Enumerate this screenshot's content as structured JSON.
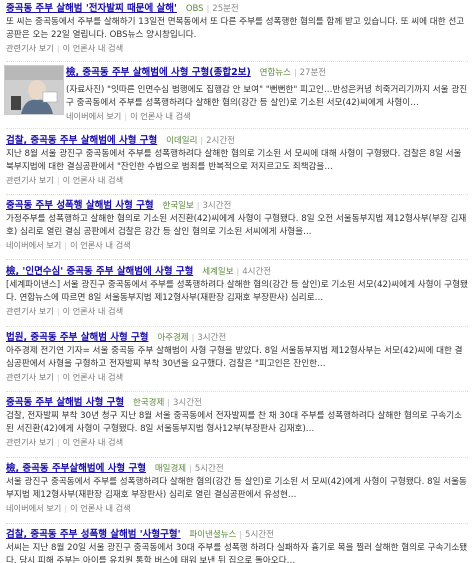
{
  "results": [
    {
      "title": "중곡동 주부 살해범 '전자발찌 때문에 살해'",
      "source": "OBS",
      "time": "25분전",
      "snippet": "또 씨는 중곡동에서 주부를 살해하기 13일전 면목동에서 또 다른 주부를 성폭행한 혐의를 함께 받고 있습니다. 또 씨에 대한 선고공판은 오는 22일 열립니다. OBS뉴스 양시창입니다.",
      "link_related": "관련기사 보기",
      "link_same": "이 언론사 내 검색"
    },
    {
      "title": "檢, 중곡동 주부 살해범에 사형 구형(종합2보)",
      "source": "연합뉴스",
      "time": "27분전",
      "snippet": "(자료사진) \"잇따른 인면수심 범행에도 집행감 안 보여\" \"뻔뻔한\" 피고인…반성은커녕 히죽거리기까지 서울 광진구 중곡동에서 주부를 성폭행하려다 살해한 혐의(강간 등 살인)로 기소된 서모(42)씨에게 사형이…",
      "link_related": "네이버에서 보기",
      "link_same": "이 언론사 내 검색"
    },
    {
      "title": "검찰, 중곡동 주부 살해범에 사형 구형",
      "source": "이데일리",
      "time": "2시간전",
      "snippet": "지난 8월 서울 광진구 중곡동에서 주부를 성폭행하려다 살해한 혐의로 기소된 서 모씨에 대해 사형이 구형됐다. 검찰은 8일 서울북부지법에 대한 결심공판에서 \"잔인한 수법으로 범죄를 반복적으로 저지르고도 죄책감을…",
      "link_related": "관련기사 보기",
      "link_same": "이 언론사 내 검색"
    },
    {
      "title": "중곡동 주부 성폭행 살해범 사형 구형",
      "source": "한국일보",
      "time": "3시간전",
      "snippet": "가정주부를 성폭행하고 살해한 혐의로 기소된 서진환(42)씨에게 사형이 구형됐다. 8일 오전 서울동부지법 제12형사부(부장 김재호) 심리로 열린 결심 공판에서 검찰은 강간 등 살인 혐의로 기소된 서씨에게 사형을…",
      "link_related": "네이버에서 보기",
      "link_same": "이 언론사 내 검색"
    },
    {
      "title": "檢, '인면수심' 중곡동 주부 살해범에 사형 구형",
      "source": "세계일보",
      "time": "4시간전",
      "snippet": "[세계파이낸스] 서울 광진구 중곡동에서 주부를 성폭행하려다 살해한 혐의(강간 등 살인)로 기소된 서모(42)씨에게 사형이 구형됐다. 연합뉴스에 따르면 8일 서울동부지법 제12형사부(재판장 김재호 부장판사) 심리로…",
      "link_related": "관련기사 보기",
      "link_same": "이 언론사 내 검색"
    },
    {
      "title": "법원, 중곡동 주부 살해범 사형 구형",
      "source": "아주경제",
      "time": "3시간전",
      "snippet": "아주경제 전기연 기자= 서울 중곡동 주부 살해범이 사형 구형을 받았다. 8일 서울동부지법 제12형사부는 서모(42)씨에 대한 결심공판에서 사형을 구형하고 전자발찌 부착 30년을 요구했다. 검찰은 \"피고인은 잔인한…",
      "link_related": "관련기사 보기",
      "link_same": "이 언론사 내 검색"
    },
    {
      "title": "중곡동 주부 살해범 사형 구형",
      "source": "한국경제",
      "time": "3시간전",
      "snippet": "검찰, 전자발찌 부착 30년 청구 지난 8월 서울 중곡동에서 전자발찌를 찬 채 30대 주부를 성폭행하려다 살해한 혐의로 구속기소된 서진환(42)에게 사형이 구형됐다. 8일 서울동부지법 형사12부(부장판사 김재호)…",
      "link_related": "관련기사 보기",
      "link_same": "이 언론사 내 검색"
    },
    {
      "title": "檢, 중곡동 주부살해범에 사형 구형",
      "source": "매일경제",
      "time": "5시간전",
      "snippet": "서울 광진구 중곡동에서 주부를 성폭행하려다 살해한 혐의(강간 등 살인)로 기소된 서 모씨(42)에게 사형이 구형됐다. 8일 서울동부지법 제12형사부(재판장 김재호 부장판사) 심리로 열린 결심공판에서 유성현…",
      "link_related": "네이버에서 보기",
      "link_same": "이 언론사 내 검색"
    },
    {
      "title": "검찰, 중곡동 주부 성폭행 살해범 '사형구형'",
      "source": "파이낸셜뉴스",
      "time": "5시간전",
      "snippet": "서씨는 지난 8월 20일 서울 광진구 중곡동에서 30대 주부를 성폭행 하려다 실패하자 흉기로 목을 찔러 살해한 혐의로 구속기소됐다. 당시 피해 주부는 아이를 유치원 통학 버스에 태워 보낸 뒤 집으로 돌아오다…",
      "link_related": "관련기사 보기",
      "link_same": "이 언론사 내 검색"
    }
  ]
}
